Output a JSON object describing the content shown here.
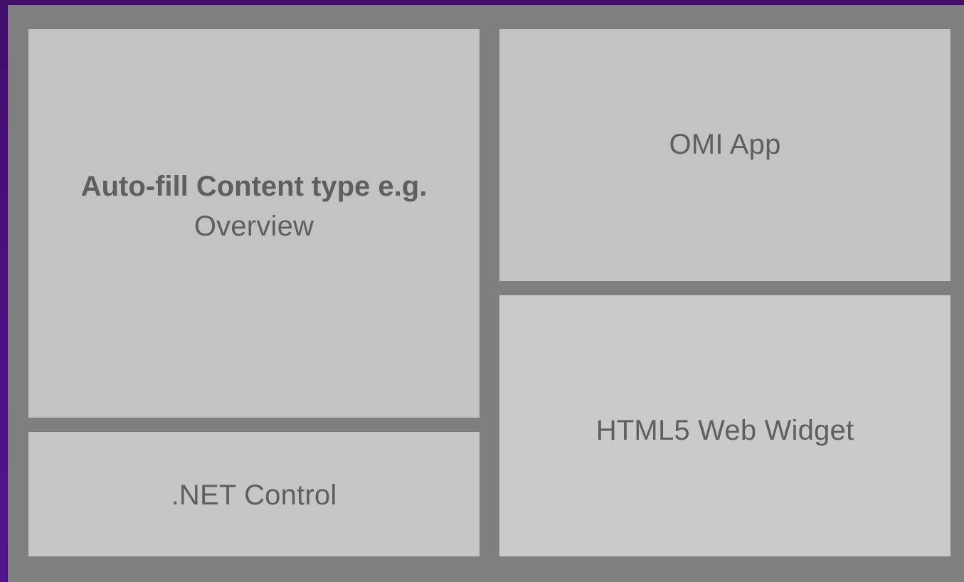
{
  "panels": {
    "auto_fill": {
      "title": "Auto-fill Content type e.g.",
      "subtitle": "Overview"
    },
    "omi_app": {
      "label": "OMI App"
    },
    "html5_widget": {
      "label": "HTML5 Web Widget"
    },
    "dotnet_control": {
      "label": ".NET Control"
    }
  },
  "colors": {
    "background_gradient_start": "#3f0f6a",
    "background_gradient_end": "#52168c",
    "frame": "#7f7f7f",
    "panel": "#c3c3c3",
    "text": "#5f5f5f"
  }
}
